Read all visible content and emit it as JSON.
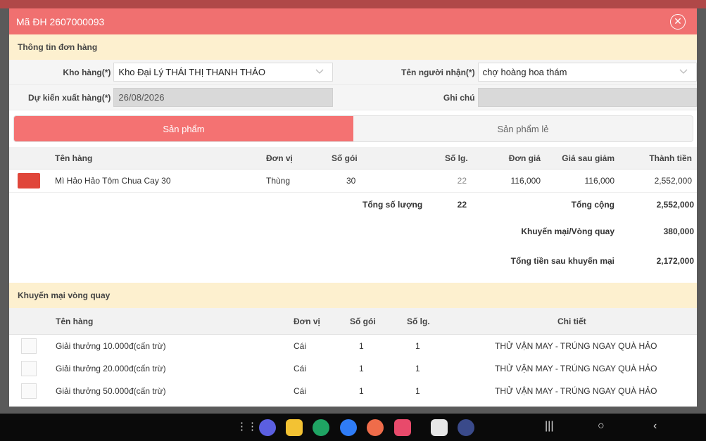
{
  "dialog": {
    "title": "Mã ĐH 2607000093",
    "close_icon": "close-icon"
  },
  "order_info": {
    "section_title": "Thông tin đơn hàng",
    "warehouse_label": "Kho hàng(*)",
    "warehouse_value": "Kho Đại Lý THÁI THỊ THANH THẢO",
    "recipient_label": "Tên người nhận(*)",
    "recipient_value": "chợ hoàng hoa thám",
    "ship_date_label": "Dự kiến xuất hàng(*)",
    "ship_date_value": "26/08/2026",
    "note_label": "Ghi chú",
    "note_value": ""
  },
  "tabs": [
    {
      "label": "Sản phẩm",
      "active": true
    },
    {
      "label": "Sản phẩm lẻ",
      "active": false
    }
  ],
  "products": {
    "columns": [
      "Tên hàng",
      "Đơn vị",
      "Số gói",
      "Số lg.",
      "Đơn giá",
      "Giá sau giảm",
      "Thành tiền"
    ],
    "rows": [
      {
        "name": "Mì Hảo Hảo Tôm Chua Cay 30",
        "unit": "Thùng",
        "packs": "30",
        "qty": "22",
        "price": "116,000",
        "discounted": "116,000",
        "total": "2,552,000"
      }
    ],
    "total_qty_label": "Tổng số lượng",
    "total_qty_value": "22",
    "total_label": "Tổng cộng",
    "total_value": "2,552,000",
    "promo_label": "Khuyến mại/Vòng quay",
    "promo_value": "380,000",
    "after_promo_label": "Tổng tiền sau khuyến mại",
    "after_promo_value": "2,172,000"
  },
  "promotions": {
    "section_title": "Khuyến mại vòng quay",
    "columns": [
      "Tên hàng",
      "Đơn vị",
      "Số gói",
      "Số lg.",
      "Chi tiết"
    ],
    "rows": [
      {
        "name": "Giải thưởng 10.000đ(cấn trừ)",
        "unit": "Cái",
        "packs": "1",
        "qty": "1",
        "detail": "THỬ VẬN MAY - TRÚNG NGAY QUÀ HẢO"
      },
      {
        "name": "Giải thưởng 20.000đ(cấn trừ)",
        "unit": "Cái",
        "packs": "1",
        "qty": "1",
        "detail": "THỬ VẬN MAY - TRÚNG NGAY QUÀ HẢO"
      },
      {
        "name": "Giải thưởng 50.000đ(cấn trừ)",
        "unit": "Cái",
        "packs": "1",
        "qty": "1",
        "detail": "THỬ VẬN MAY - TRÚNG NGAY QUÀ HẢO"
      }
    ]
  },
  "colors": {
    "accent": "#f47272",
    "section_bg": "#fdf0cf"
  }
}
